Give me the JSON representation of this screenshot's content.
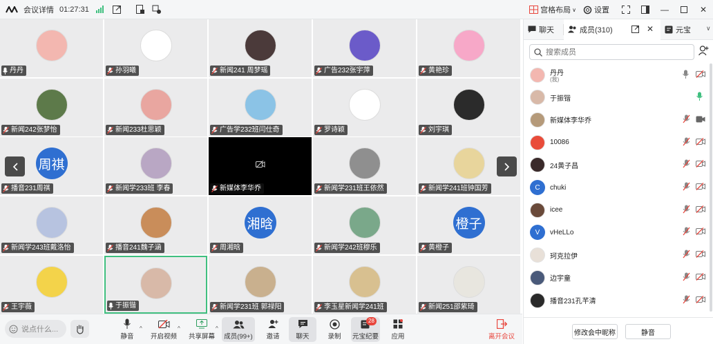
{
  "topbar": {
    "meeting_info": "会议详情",
    "timer": "01:27:31",
    "layout": "宫格布局",
    "settings": "设置"
  },
  "tiles": [
    {
      "name": "丹丹",
      "avatar_type": "image",
      "avatar_color": "#f3b7b0",
      "mic": "on"
    },
    {
      "name": "孙羽曦",
      "avatar_type": "image",
      "avatar_color": "#ffffff",
      "mic": "off"
    },
    {
      "name": "新闻241 周梦瑶",
      "avatar_type": "image",
      "avatar_color": "#4b3a3a",
      "mic": "off"
    },
    {
      "name": "广告232张宇萍",
      "avatar_type": "image",
      "avatar_color": "#6b5bc9",
      "mic": "off"
    },
    {
      "name": "黄艳珍",
      "avatar_type": "image",
      "avatar_color": "#f7a8c8",
      "mic": "off"
    },
    {
      "name": "新闻242张梦怡",
      "avatar_type": "image",
      "avatar_color": "#5d7a4a",
      "mic": "off"
    },
    {
      "name": "新闻233杜思颖",
      "avatar_type": "image",
      "avatar_color": "#e9a6a0",
      "mic": "off"
    },
    {
      "name": "广告学232班闫仕奇",
      "avatar_type": "image",
      "avatar_color": "#8bc3e6",
      "mic": "off"
    },
    {
      "name": "罗诗颖",
      "avatar_type": "image",
      "avatar_color": "#ffffff",
      "mic": "off"
    },
    {
      "name": "刘宇琪",
      "avatar_type": "image",
      "avatar_color": "#2b2b2b",
      "mic": "off"
    },
    {
      "name": "播音231周祺",
      "avatar_type": "text",
      "avatar_text": "周祺",
      "mic": "off"
    },
    {
      "name": "新闻学233班 李春",
      "avatar_type": "image",
      "avatar_color": "#b9a7c4",
      "mic": "off"
    },
    {
      "name": "新媒体李华乔",
      "avatar_type": "video_off",
      "mic": "off"
    },
    {
      "name": "新闻学231班王依然",
      "avatar_type": "image",
      "avatar_color": "#8f8f8f",
      "mic": "off"
    },
    {
      "name": "新闻学241班钟国芳",
      "avatar_type": "image",
      "avatar_color": "#e8d59c",
      "mic": "off"
    },
    {
      "name": "新闻学243班戴洛怡",
      "avatar_type": "image",
      "avatar_color": "#b7c3e0",
      "mic": "off"
    },
    {
      "name": "播音241魏子涵",
      "avatar_type": "image",
      "avatar_color": "#c98d5a",
      "mic": "off"
    },
    {
      "name": "周湘晗",
      "avatar_type": "text",
      "avatar_text": "湘晗",
      "mic": "off"
    },
    {
      "name": "新闻学242班穆乐",
      "avatar_type": "image",
      "avatar_color": "#7aa88a",
      "mic": "off"
    },
    {
      "name": "黄橙子",
      "avatar_type": "text",
      "avatar_text": "橙子",
      "mic": "off"
    },
    {
      "name": "王宇薇",
      "avatar_type": "image",
      "avatar_color": "#f3d34a",
      "mic": "off"
    },
    {
      "name": "于振锴",
      "avatar_type": "image",
      "avatar_color": "#d8b9a8",
      "mic": "on",
      "active": true
    },
    {
      "name": "新闻学231班 郭禄阳",
      "avatar_type": "image",
      "avatar_color": "#c9b08e",
      "mic": "off"
    },
    {
      "name": "李玉星新闻学241班",
      "avatar_type": "image",
      "avatar_color": "#d8c090",
      "mic": "off"
    },
    {
      "name": "新闻251邵紫琦",
      "avatar_type": "image",
      "avatar_color": "#e8e6df",
      "mic": "off"
    }
  ],
  "bottombar": {
    "chat_placeholder": "说点什么...",
    "mute": "静音",
    "video": "开启视频",
    "share": "共享屏幕",
    "members": "成员(99+)",
    "invite": "邀请",
    "chat": "聊天",
    "record": "录制",
    "summary": "元宝纪要",
    "summary_badge": "28",
    "apps": "应用",
    "leave": "离开会议"
  },
  "panel": {
    "tab_chat": "聊天",
    "tab_members": "成员(310)",
    "tab_yuanbao": "元宝",
    "search_placeholder": "搜索成员",
    "rename_button": "修改会中昵称",
    "mute_button": "静音",
    "members": [
      {
        "name": "丹丹",
        "sub": "(我)",
        "avatar_type": "image",
        "avatar_color": "#f3b7b0",
        "mic": "on",
        "cam": "off"
      },
      {
        "name": "于振锴",
        "avatar_type": "image",
        "avatar_color": "#d8b9a8",
        "mic": "speaking",
        "cam": "none"
      },
      {
        "name": "新媒体李华乔",
        "avatar_type": "image",
        "avatar_color": "#b59a7a",
        "mic": "off",
        "cam": "on"
      },
      {
        "name": "10086",
        "avatar_type": "image",
        "avatar_color": "#e94c3a",
        "mic": "off",
        "cam": "off"
      },
      {
        "name": "24黄子昌",
        "avatar_type": "image",
        "avatar_color": "#3a2a2a",
        "mic": "off",
        "cam": "off"
      },
      {
        "name": "chuki",
        "avatar_type": "text",
        "avatar_text": "C",
        "mic": "off",
        "cam": "off"
      },
      {
        "name": "icee",
        "avatar_type": "image",
        "avatar_color": "#6a4a3a",
        "mic": "off",
        "cam": "off"
      },
      {
        "name": "vHeLLo",
        "avatar_type": "text",
        "avatar_text": "V",
        "mic": "off",
        "cam": "off"
      },
      {
        "name": "珂克拉伊",
        "avatar_type": "image",
        "avatar_color": "#e8e0d8",
        "mic": "off",
        "cam": "off"
      },
      {
        "name": "边宇童",
        "avatar_type": "image",
        "avatar_color": "#4a5a7a",
        "mic": "off",
        "cam": "off"
      },
      {
        "name": "播音231孔芊清",
        "avatar_type": "image",
        "avatar_color": "#2a2a2a",
        "mic": "off",
        "cam": "off"
      }
    ]
  },
  "colors": {
    "brand_blue": "#2f6fd1",
    "mic_green": "#3fbf7f",
    "danger_red": "#e8453c"
  }
}
